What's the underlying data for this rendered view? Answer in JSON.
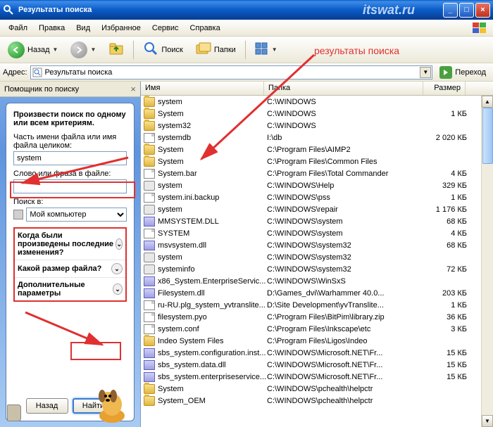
{
  "window": {
    "title": "Результаты поиска",
    "watermark": "itswat.ru"
  },
  "menu": {
    "file": "Файл",
    "edit": "Правка",
    "view": "Вид",
    "favorites": "Избранное",
    "tools": "Сервис",
    "help": "Справка"
  },
  "toolbar": {
    "back": "Назад",
    "search": "Поиск",
    "folders": "Папки"
  },
  "address": {
    "label": "Адрес:",
    "value": "Результаты поиска",
    "go": "Переход"
  },
  "sidebar": {
    "header": "Помощник по поиску",
    "title": "Произвести поиск по одному или всем критериям.",
    "filename_label": "Часть имени файла или имя файла целиком:",
    "filename_value": "system",
    "phrase_label": "Слово или фраза в файле:",
    "phrase_value": "",
    "lookin_label": "Поиск в:",
    "lookin_value": "Мой компьютер",
    "opts": {
      "when": "Когда были произведены последние изменения?",
      "size": "Какой размер файла?",
      "more": "Дополнительные параметры"
    },
    "buttons": {
      "back": "Назад",
      "search": "Найти"
    }
  },
  "columns": {
    "name": "Имя",
    "path": "Папка",
    "size": "Размер"
  },
  "annotation": "результаты поиска",
  "files": [
    {
      "t": "folder",
      "name": "system",
      "path": "C:\\WINDOWS",
      "size": ""
    },
    {
      "t": "folder",
      "name": "System",
      "path": "C:\\WINDOWS",
      "size": "1 КБ"
    },
    {
      "t": "folder",
      "name": "system32",
      "path": "C:\\WINDOWS",
      "size": ""
    },
    {
      "t": "doc",
      "name": "systemdb",
      "path": "I:\\db",
      "size": "2 020 КБ"
    },
    {
      "t": "folder",
      "name": "System",
      "path": "C:\\Program Files\\AIMP2",
      "size": ""
    },
    {
      "t": "folder",
      "name": "System",
      "path": "C:\\Program Files\\Common Files",
      "size": ""
    },
    {
      "t": "doc",
      "name": "System.bar",
      "path": "C:\\Program Files\\Total Commander",
      "size": "4 КБ"
    },
    {
      "t": "gear",
      "name": "system",
      "path": "C:\\WINDOWS\\Help",
      "size": "329 КБ"
    },
    {
      "t": "doc",
      "name": "system.ini.backup",
      "path": "C:\\WINDOWS\\pss",
      "size": "1 КБ"
    },
    {
      "t": "gear",
      "name": "system",
      "path": "C:\\WINDOWS\\repair",
      "size": "1 176 КБ"
    },
    {
      "t": "dll",
      "name": "MMSYSTEM.DLL",
      "path": "C:\\WINDOWS\\system",
      "size": "68 КБ"
    },
    {
      "t": "doc",
      "name": "SYSTEM",
      "path": "C:\\WINDOWS\\system",
      "size": "4 КБ"
    },
    {
      "t": "dll",
      "name": "msvsystem.dll",
      "path": "C:\\WINDOWS\\system32",
      "size": "68 КБ"
    },
    {
      "t": "gear",
      "name": "system",
      "path": "C:\\WINDOWS\\system32",
      "size": ""
    },
    {
      "t": "gear",
      "name": "systeminfo",
      "path": "C:\\WINDOWS\\system32",
      "size": "72 КБ"
    },
    {
      "t": "dll",
      "name": "x86_System.EnterpriseServic...",
      "path": "C:\\WINDOWS\\WinSxS",
      "size": ""
    },
    {
      "t": "dll",
      "name": "Filesystem.dll",
      "path": "D:\\Games_dvi\\Warhammer 40.0...",
      "size": "203 КБ"
    },
    {
      "t": "doc",
      "name": "ru-RU.plg_system_yvtranslite...",
      "path": "D:\\Site Development\\yvTranslite...",
      "size": "1 КБ"
    },
    {
      "t": "doc",
      "name": "filesystem.pyo",
      "path": "C:\\Program Files\\BitPim\\library.zip",
      "size": "36 КБ"
    },
    {
      "t": "doc",
      "name": "system.conf",
      "path": "C:\\Program Files\\Inkscape\\etc",
      "size": "3 КБ"
    },
    {
      "t": "folder",
      "name": "Indeo System Files",
      "path": "C:\\Program Files\\Ligos\\Indeo",
      "size": ""
    },
    {
      "t": "dll",
      "name": "sbs_system.configuration.inst...",
      "path": "C:\\WINDOWS\\Microsoft.NET\\Fr...",
      "size": "15 КБ"
    },
    {
      "t": "dll",
      "name": "sbs_system.data.dll",
      "path": "C:\\WINDOWS\\Microsoft.NET\\Fr...",
      "size": "15 КБ"
    },
    {
      "t": "dll",
      "name": "sbs_system.enterpriseservice...",
      "path": "C:\\WINDOWS\\Microsoft.NET\\Fr...",
      "size": "15 КБ"
    },
    {
      "t": "folder",
      "name": "System",
      "path": "C:\\WINDOWS\\pchealth\\helpctr",
      "size": ""
    },
    {
      "t": "folder",
      "name": "System_OEM",
      "path": "C:\\WINDOWS\\pchealth\\helpctr",
      "size": ""
    }
  ]
}
